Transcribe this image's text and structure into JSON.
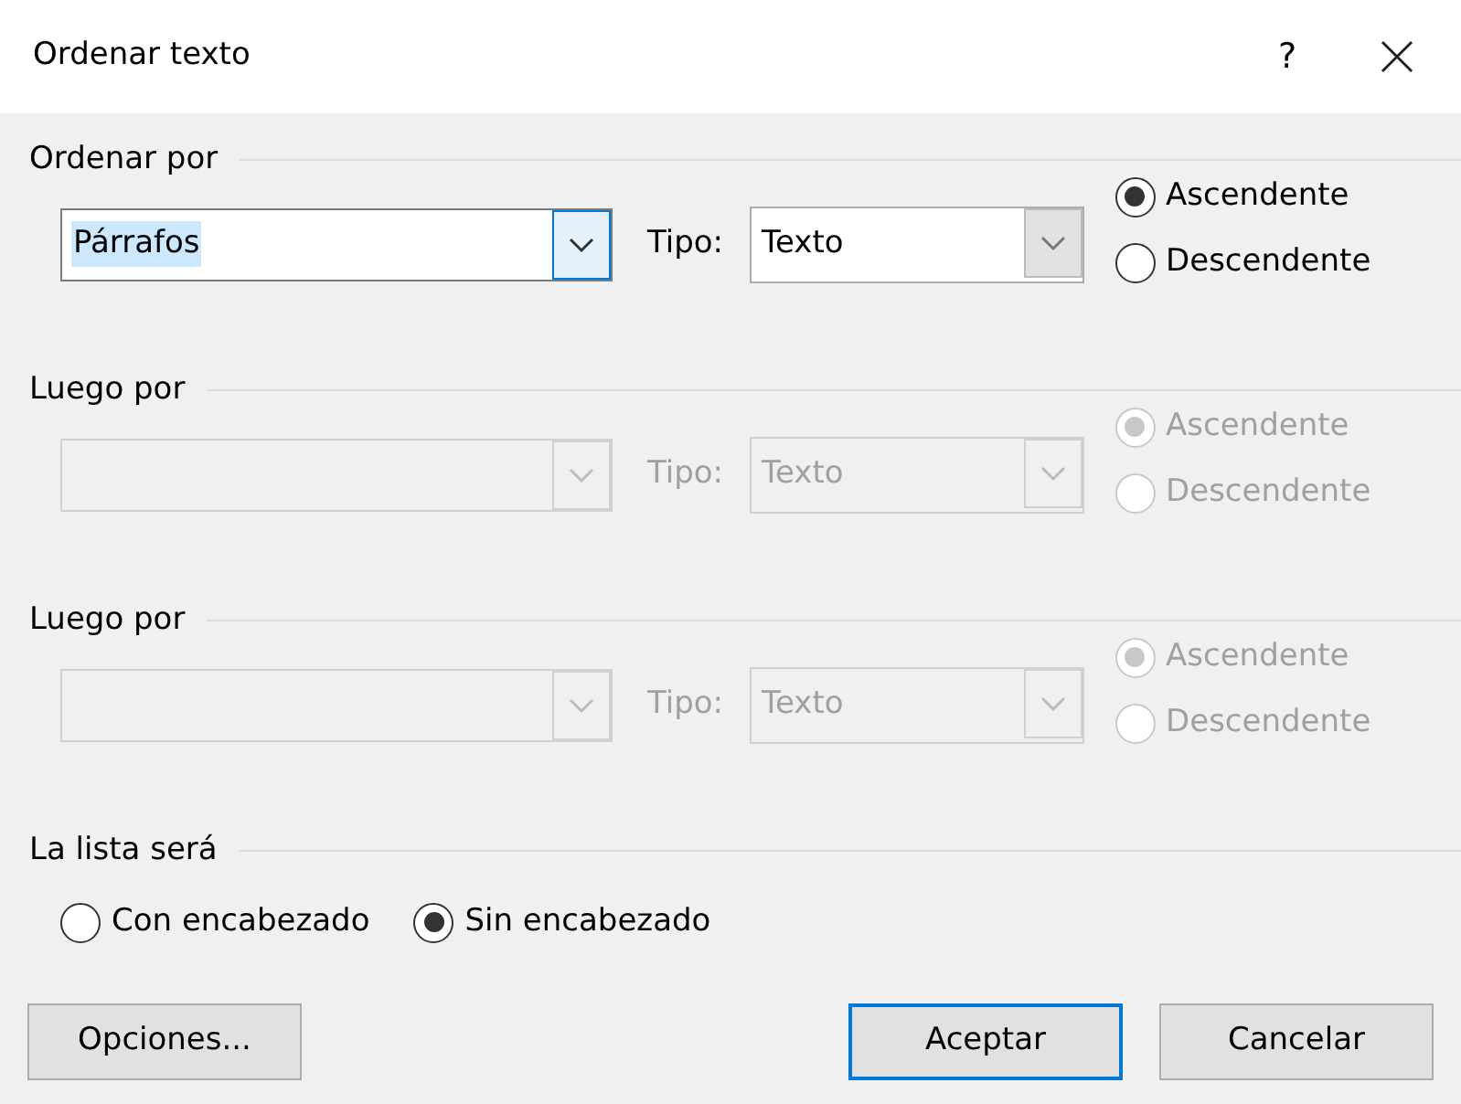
{
  "window": {
    "title": "Ordenar texto",
    "help": "?"
  },
  "sections": [
    {
      "label": "Ordenar por",
      "field": {
        "value": "Párrafos",
        "focused": true
      },
      "type_label": "Tipo:",
      "type_value": "Texto",
      "disabled": false,
      "radios": [
        {
          "label": "Ascendente",
          "selected": true
        },
        {
          "label": "Descendente",
          "selected": false
        }
      ]
    },
    {
      "label": "Luego por",
      "field": {
        "focused": false
      },
      "type_label": "Tipo:",
      "type_value": "Texto",
      "disabled": true,
      "radios": [
        {
          "label": "Ascendente",
          "selected": true
        },
        {
          "label": "Descendente",
          "selected": false
        }
      ]
    },
    {
      "label": "Luego por",
      "field": {
        "focused": false
      },
      "type_label": "Tipo:",
      "type_value": "Texto",
      "disabled": true,
      "radios": [
        {
          "label": "Ascendente",
          "selected": true
        },
        {
          "label": "Descendente",
          "selected": false
        }
      ]
    }
  ],
  "list": {
    "label": "La lista será",
    "radios": [
      {
        "label": "Con encabezado",
        "selected": false
      },
      {
        "label": "Sin encabezado",
        "selected": true
      }
    ]
  },
  "buttons": [
    {
      "label": "Opciones...",
      "default": false
    },
    {
      "label": "Aceptar",
      "default": true
    },
    {
      "label": "Cancelar",
      "default": false
    }
  ]
}
